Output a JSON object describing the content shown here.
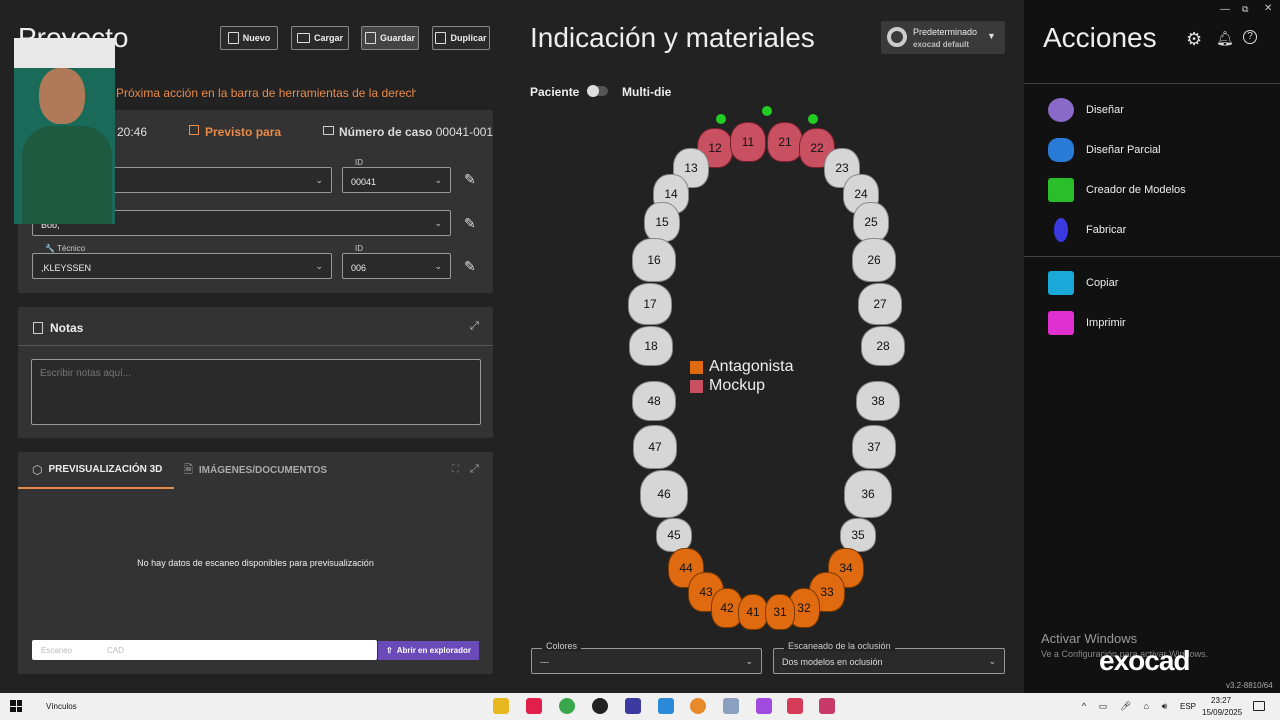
{
  "project": {
    "title": "Proyecto",
    "buttons": {
      "new": "Nuevo",
      "load": "Cargar",
      "save": "Guardar",
      "duplicate": "Duplicar"
    },
    "hint": "Próxima acción en la barra de herramientas de la derecha",
    "time": "20:46",
    "planned_for": "Previsto para",
    "case_number_label": "Número de caso",
    "case_number": "00041-001",
    "id_label": "ID",
    "client_id": "00041",
    "patient_value": "Bob,",
    "technician_label": "Técnico",
    "technician_value": ",KLEYSSEN",
    "technician_id": "006"
  },
  "notes": {
    "title": "Notas",
    "placeholder": "Escribir notas aquí..."
  },
  "preview": {
    "tab_3d": "PREVISUALIZACIÓN 3D",
    "tab_docs": "IMÁGENES/DOCUMENTOS",
    "empty": "No hay datos de escaneo disponibles para previsualización",
    "scan_label": "Escaneo",
    "cad_label": "CAD",
    "open_explorer": "Abrir en explorador"
  },
  "indication": {
    "title": "Indicación y materiales",
    "preset": "Predeterminado",
    "preset_sub": "exocad default",
    "patient": "Paciente",
    "multidie": "Multi-die",
    "legend": [
      {
        "label": "Antagonista",
        "color": "#e06a10"
      },
      {
        "label": "Mockup",
        "color": "#c85060"
      }
    ],
    "colors_label": "Colores",
    "colors_value": "---",
    "occlusion_label": "Escaneado de la oclusión",
    "occlusion_value": "Dos modelos en oclusión"
  },
  "teeth": {
    "upper_right": [
      "18",
      "17",
      "16",
      "15",
      "14",
      "13",
      "12",
      "11"
    ],
    "upper_left": [
      "21",
      "22",
      "23",
      "24",
      "25",
      "26",
      "27",
      "28"
    ],
    "lower_left": [
      "38",
      "37",
      "36",
      "35",
      "34",
      "33",
      "32",
      "31"
    ],
    "lower_right": [
      "41",
      "42",
      "43",
      "44",
      "45",
      "46",
      "47",
      "48"
    ],
    "mockup": [
      "12",
      "11",
      "21",
      "22"
    ],
    "antagonist": [
      "44",
      "43",
      "42",
      "41",
      "31",
      "32",
      "33",
      "34"
    ]
  },
  "actions": {
    "title": "Acciones",
    "items": [
      {
        "label": "Diseñar",
        "color": "#8a6ac8"
      },
      {
        "label": "Diseñar Parcial",
        "color": "#2a7ad8"
      },
      {
        "label": "Creador de Modelos",
        "color": "#2abf2a"
      },
      {
        "label": "Fabricar",
        "color": "#3a3ae0"
      },
      {
        "label": "Copiar",
        "color": "#1aa8d8"
      },
      {
        "label": "Imprimir",
        "color": "#e030d0"
      }
    ]
  },
  "watermark": {
    "line1": "Activar Windows",
    "line2": "Ve a Configuración para activar Windows.",
    "brand": "exocad",
    "version": "v3.2-8810/64"
  },
  "taskbar": {
    "links": "Vínculos",
    "lang": "ESP",
    "time": "23:27",
    "date": "15/09/2025"
  }
}
